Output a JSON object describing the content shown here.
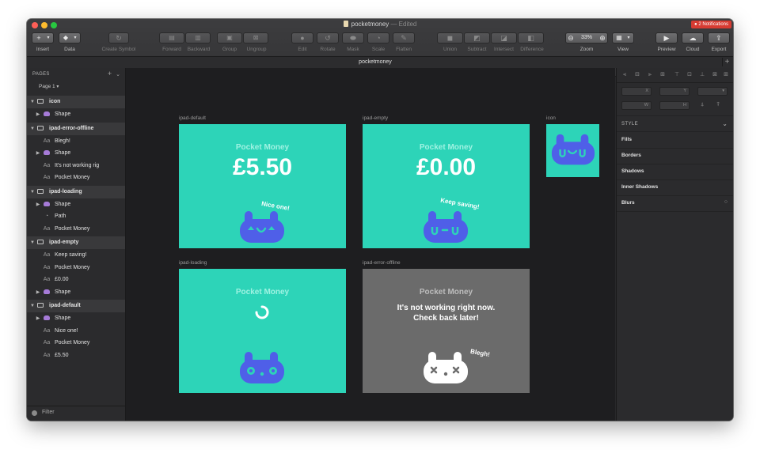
{
  "window": {
    "title": "pocketmoney",
    "edited": "— Edited",
    "notifications": "2 Notifications",
    "colors": {
      "close": "#ff5f57",
      "minimize": "#febc2e",
      "zoom": "#28c840"
    }
  },
  "toolbar": {
    "insert": "Insert",
    "data": "Data",
    "create_symbol": "Create Symbol",
    "forward": "Forward",
    "backward": "Backward",
    "group": "Group",
    "ungroup": "Ungroup",
    "edit": "Edit",
    "rotate": "Rotate",
    "mask": "Mask",
    "scale": "Scale",
    "flatten": "Flatten",
    "union": "Union",
    "subtract": "Subtract",
    "intersect": "Intersect",
    "difference": "Difference",
    "zoom_value": "33%",
    "zoom": "Zoom",
    "view": "View",
    "preview": "Preview",
    "cloud": "Cloud",
    "export": "Export"
  },
  "tab": {
    "name": "pocketmoney"
  },
  "layers": {
    "header": "PAGES",
    "page": "Page 1",
    "groups": [
      {
        "name": "icon",
        "children": [
          {
            "type": "shape",
            "name": "Shape",
            "expandable": true
          }
        ]
      },
      {
        "name": "ipad-error-offline",
        "children": [
          {
            "type": "text",
            "name": "Blegh!"
          },
          {
            "type": "shape",
            "name": "Shape",
            "expandable": true
          },
          {
            "type": "text",
            "name": "It's not working rig"
          },
          {
            "type": "text",
            "name": "Pocket Money"
          }
        ]
      },
      {
        "name": "ipad-loading",
        "children": [
          {
            "type": "shape",
            "name": "Shape",
            "expandable": true
          },
          {
            "type": "path",
            "name": "Path"
          },
          {
            "type": "text",
            "name": "Pocket Money"
          }
        ]
      },
      {
        "name": "ipad-empty",
        "children": [
          {
            "type": "text",
            "name": "Keep saving!"
          },
          {
            "type": "text",
            "name": "Pocket Money"
          },
          {
            "type": "text",
            "name": "£0.00"
          },
          {
            "type": "shape",
            "name": "Shape",
            "expandable": true
          }
        ]
      },
      {
        "name": "ipad-default",
        "children": [
          {
            "type": "shape",
            "name": "Shape",
            "expandable": true
          },
          {
            "type": "text",
            "name": "Nice one!"
          },
          {
            "type": "text",
            "name": "Pocket Money"
          },
          {
            "type": "text",
            "name": "£5.50"
          }
        ]
      }
    ],
    "filter": "Filter"
  },
  "canvas": {
    "artboards": {
      "default": {
        "label": "ipad-default",
        "title": "Pocket Money",
        "amount": "£5.50",
        "tag": "Nice one!"
      },
      "empty": {
        "label": "ipad-empty",
        "title": "Pocket Money",
        "amount": "£0.00",
        "tag": "Keep saving!"
      },
      "icon": {
        "label": "icon"
      },
      "loading": {
        "label": "ipad-loading",
        "title": "Pocket Money"
      },
      "error": {
        "label": "ipad-error-offline",
        "title": "Pocket Money",
        "message_line1": "It's not working right now.",
        "message_line2": "Check back later!",
        "tag": "Blegh!"
      }
    },
    "colors": {
      "teal": "#2dd4b8",
      "blob": "#4f5fe8",
      "grey": "#6b6b6b"
    }
  },
  "inspector": {
    "x": "X",
    "y": "Y",
    "w": "W",
    "h": "H",
    "style": "STYLE",
    "fills": "Fills",
    "borders": "Borders",
    "shadows": "Shadows",
    "inner_shadows": "Inner Shadows",
    "blurs": "Blurs"
  }
}
